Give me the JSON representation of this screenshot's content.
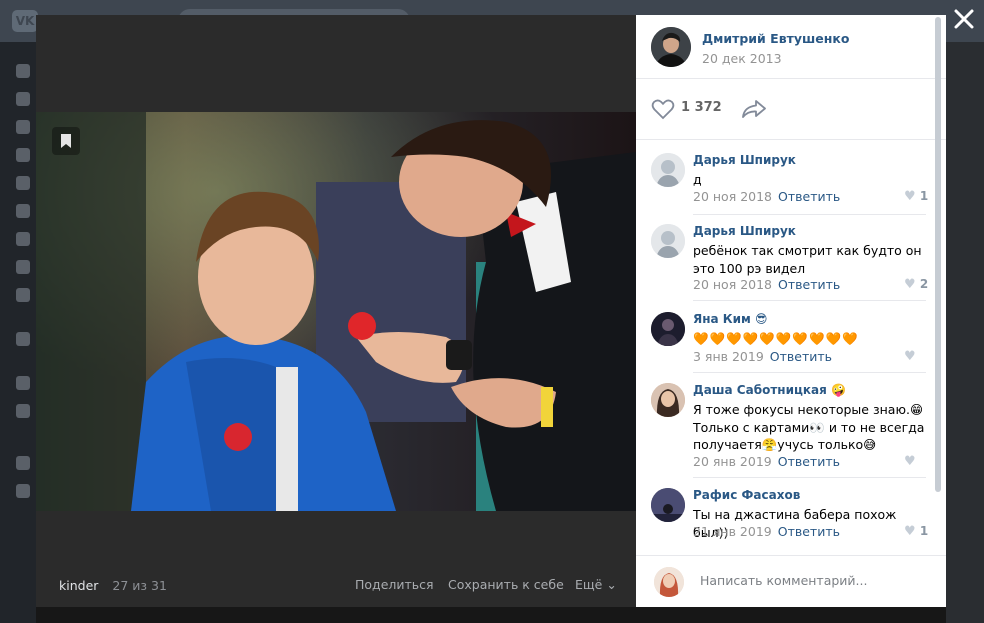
{
  "background": {
    "logo": "VK"
  },
  "viewer": {
    "album": "kinder",
    "counter": "27 из 31",
    "share": "Поделиться",
    "save": "Сохранить к себе",
    "more": "Ещё"
  },
  "post": {
    "author": "Дмитрий Евтушенко",
    "date": "20 дек 2013",
    "likes": "1 372"
  },
  "comments": [
    {
      "name": "Дарья Шпирук",
      "text": "д",
      "date": "20 ноя 2018",
      "reply": "Ответить",
      "likes": "1"
    },
    {
      "name": "Дарья Шпирук",
      "text": "ребёнок так смотрит как будто он это 100 рэ видел",
      "date": "20 ноя 2018",
      "reply": "Ответить",
      "likes": "2"
    },
    {
      "name": "Яна Ким 😎",
      "text": "🧡🧡🧡🧡🧡🧡🧡🧡🧡🧡",
      "date": "3 янв 2019",
      "reply": "Ответить",
      "likes": ""
    },
    {
      "name": "Даша Саботницкая 🤪",
      "text": "Я тоже фокусы некоторые знаю.😁 Только с картами👀 и то не всегда получаетя😤учусь только😅",
      "date": "20 янв 2019",
      "reply": "Ответить",
      "likes": ""
    },
    {
      "name": "Рафис Фасахов",
      "text": "Ты на джастина бабера похож был))",
      "date": "21 янв 2019",
      "reply": "Ответить",
      "likes": "1"
    }
  ],
  "composer": {
    "placeholder": "Написать комментарий..."
  },
  "colors": {
    "link": "#2a5885",
    "muted": "#939393",
    "heart": "#c5cdd6"
  }
}
